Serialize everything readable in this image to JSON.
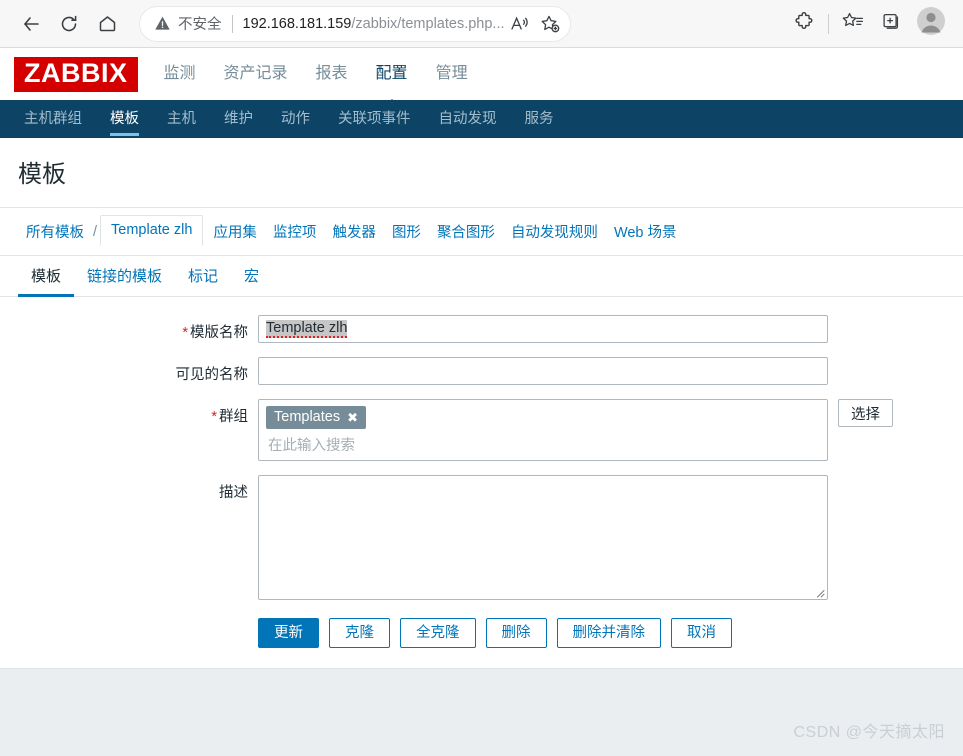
{
  "browser": {
    "back_icon": "back-arrow-icon",
    "reload_icon": "reload-icon",
    "home_icon": "home-icon",
    "security_label": "不安全",
    "url_host": "192.168.181.159",
    "url_path": "/zabbix/templates.php...",
    "read_aloud_icon": "read-aloud-icon",
    "add_favorite_icon": "add-favorite-star-icon",
    "extensions_icon": "extensions-puzzle-icon",
    "favorites_icon": "favorites-list-icon",
    "collections_icon": "add-to-collections-icon",
    "profile_icon": "profile-avatar-icon"
  },
  "header": {
    "logo": "ZABBIX",
    "logo_color": "#d40000",
    "nav": [
      {
        "label": "监测",
        "active": false
      },
      {
        "label": "资产记录",
        "active": false
      },
      {
        "label": "报表",
        "active": false
      },
      {
        "label": "配置",
        "active": true
      },
      {
        "label": "管理",
        "active": false
      }
    ]
  },
  "subnav": {
    "bg_color": "#0d4466",
    "items": [
      {
        "label": "主机群组",
        "active": false
      },
      {
        "label": "模板",
        "active": true
      },
      {
        "label": "主机",
        "active": false
      },
      {
        "label": "维护",
        "active": false
      },
      {
        "label": "动作",
        "active": false
      },
      {
        "label": "关联项事件",
        "active": false
      },
      {
        "label": "自动发现",
        "active": false
      },
      {
        "label": "服务",
        "active": false
      }
    ]
  },
  "page": {
    "title": "模板",
    "breadcrumb": {
      "all_templates": "所有模板",
      "separator": "/",
      "current": "Template zlh",
      "links": [
        "应用集",
        "监控项",
        "触发器",
        "图形",
        "聚合图形",
        "自动发现规则",
        "Web 场景"
      ]
    },
    "form_tabs": [
      {
        "label": "模板",
        "active": true
      },
      {
        "label": "链接的模板",
        "active": false
      },
      {
        "label": "标记",
        "active": false
      },
      {
        "label": "宏",
        "active": false
      }
    ],
    "form": {
      "template_name": {
        "label": "模版名称",
        "required": true,
        "value": "Template zlh"
      },
      "visible_name": {
        "label": "可见的名称",
        "required": false,
        "value": "",
        "placeholder": ""
      },
      "groups": {
        "label": "群组",
        "required": true,
        "chips": [
          "Templates"
        ],
        "chip_remove_icon": "remove-chip-icon",
        "placeholder": "在此输入搜索",
        "select_button": "选择"
      },
      "description": {
        "label": "描述",
        "required": false,
        "value": "",
        "resize_handle_icon": "resize-grip-icon"
      }
    },
    "buttons": [
      {
        "label": "更新",
        "style": "primary"
      },
      {
        "label": "克隆",
        "style": "secondary"
      },
      {
        "label": "全克隆",
        "style": "secondary"
      },
      {
        "label": "删除",
        "style": "secondary"
      },
      {
        "label": "删除并清除",
        "style": "secondary"
      },
      {
        "label": "取消",
        "style": "secondary"
      }
    ],
    "watermark": "CSDN @今天摘太阳",
    "accent_color": "#0275b8"
  }
}
